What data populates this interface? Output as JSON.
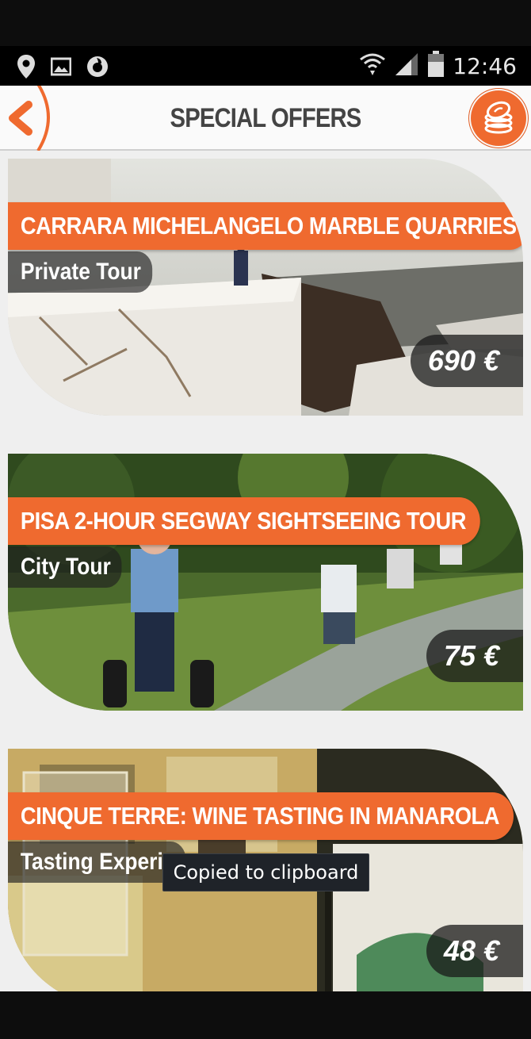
{
  "status_bar": {
    "time": "12:46",
    "icons": [
      "location-icon",
      "image-icon",
      "vodafone-icon",
      "wifi-icon",
      "signal-icon",
      "battery-icon"
    ]
  },
  "app_bar": {
    "title": "SPECIAL OFFERS",
    "accent_color": "#ef6a2f",
    "back_icon": "chevron-left-icon",
    "action_icon": "coins-offer-icon"
  },
  "offers": [
    {
      "title": "CARRARA MICHELANGELO MARBLE QUARRIES",
      "category": "Private Tour",
      "price": "690 €",
      "image": "marble-quarry-photo"
    },
    {
      "title": "PISA 2-HOUR SEGWAY SIGHTSEEING TOUR",
      "category": "City Tour",
      "price": "75 €",
      "image": "segway-tour-photo"
    },
    {
      "title": "CINQUE TERRE: WINE TASTING IN MANAROLA",
      "category": "Tasting Experie",
      "price": "48 €",
      "image": "wine-bottle-photo"
    }
  ],
  "toast": {
    "message": "Copied to clipboard"
  }
}
